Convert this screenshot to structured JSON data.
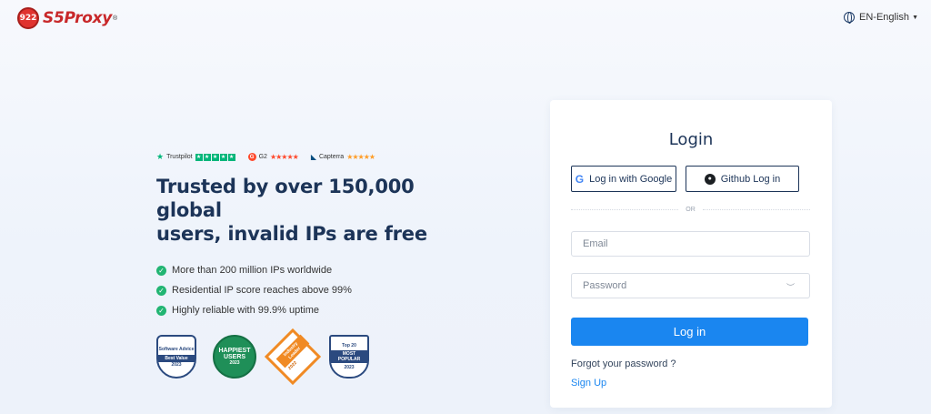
{
  "header": {
    "logo_badge": "922",
    "logo_text": "S5Proxy",
    "logo_reg": "®",
    "language": "EN-English"
  },
  "ratings": {
    "trustpilot": "Trustpilot",
    "g2": "G2",
    "capterra": "Capterra"
  },
  "hero": {
    "headline_line1": "Trusted by over 150,000 global",
    "headline_line2": "users, invalid IPs are free",
    "features": [
      "More than 200 million IPs worldwide",
      "Residential IP score reaches above 99%",
      "Highly reliable with 99.9% uptime"
    ]
  },
  "badges": {
    "software_advice": {
      "top": "Software Advice",
      "band": "Best Value",
      "bottom": "2023"
    },
    "happiest": {
      "top": "HAPPIEST",
      "bottom": "USERS",
      "year": "2023"
    },
    "leader": {
      "top": "Industry Leader",
      "year": "2022"
    },
    "getapp": {
      "top": "Top 20",
      "band": "MOST POPULAR",
      "bottom": "2023"
    }
  },
  "login": {
    "title": "Login",
    "google_label": "Log in with Google",
    "github_label": "Github Log in",
    "divider": "OR",
    "email_placeholder": "Email",
    "password_placeholder": "Password",
    "submit": "Log in",
    "forgot": "Forgot your password ?",
    "signup": "Sign Up"
  },
  "colors": {
    "brand_red": "#c8282a",
    "primary_blue": "#1a86f0",
    "heading_navy": "#1c3458",
    "check_green": "#22b573"
  }
}
